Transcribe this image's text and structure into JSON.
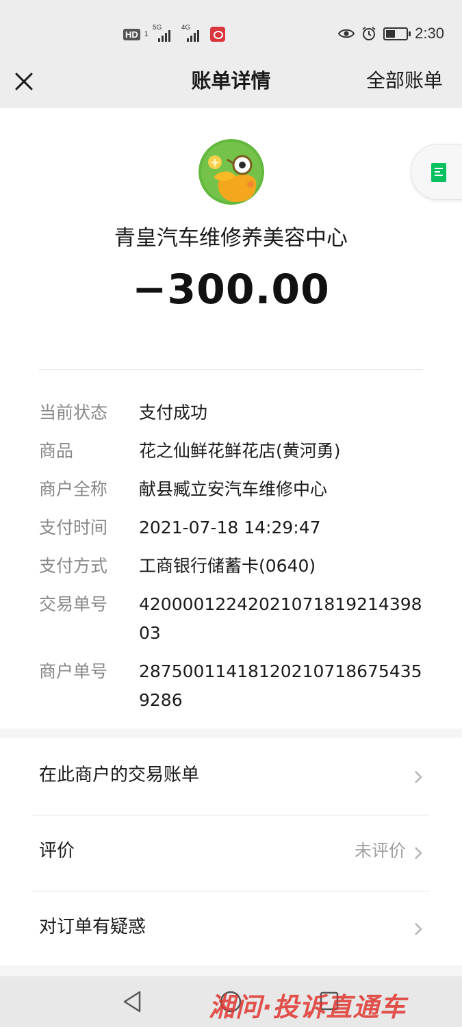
{
  "status_bar": {
    "hd_label": "HD",
    "sim_slot": "1",
    "network_1": "5G",
    "network_2": "4G",
    "time": "2:30"
  },
  "nav": {
    "title": "账单详情",
    "all_bills": "全部账单"
  },
  "header": {
    "merchant_name": "青皇汽车维修养美容中心",
    "amount": "−300.00"
  },
  "details": [
    {
      "label": "当前状态",
      "value": "支付成功"
    },
    {
      "label": "商品",
      "value": "花之仙鲜花鲜花店(黄河勇)"
    },
    {
      "label": "商户全称",
      "value": "献县臧立安汽车维修中心"
    },
    {
      "label": "支付时间",
      "value": "2021-07-18 14:29:47"
    },
    {
      "label": "支付方式",
      "value": "工商银行储蓄卡(0640)"
    },
    {
      "label": "交易单号",
      "value": "4200001224202107181921439803"
    },
    {
      "label": "商户单号",
      "value": "287500114181202107186754359286"
    }
  ],
  "menu": {
    "merchant_bills": "在此商户的交易账单",
    "rate_label": "评价",
    "rate_status": "未评价",
    "question": "对订单有疑惑"
  },
  "watermark": "湘问·投诉直通车",
  "colors": {
    "bar_bg": "#ededed",
    "label_gray": "#888888",
    "watermark_red": "#e0302a",
    "icon_green": "#07c160"
  }
}
